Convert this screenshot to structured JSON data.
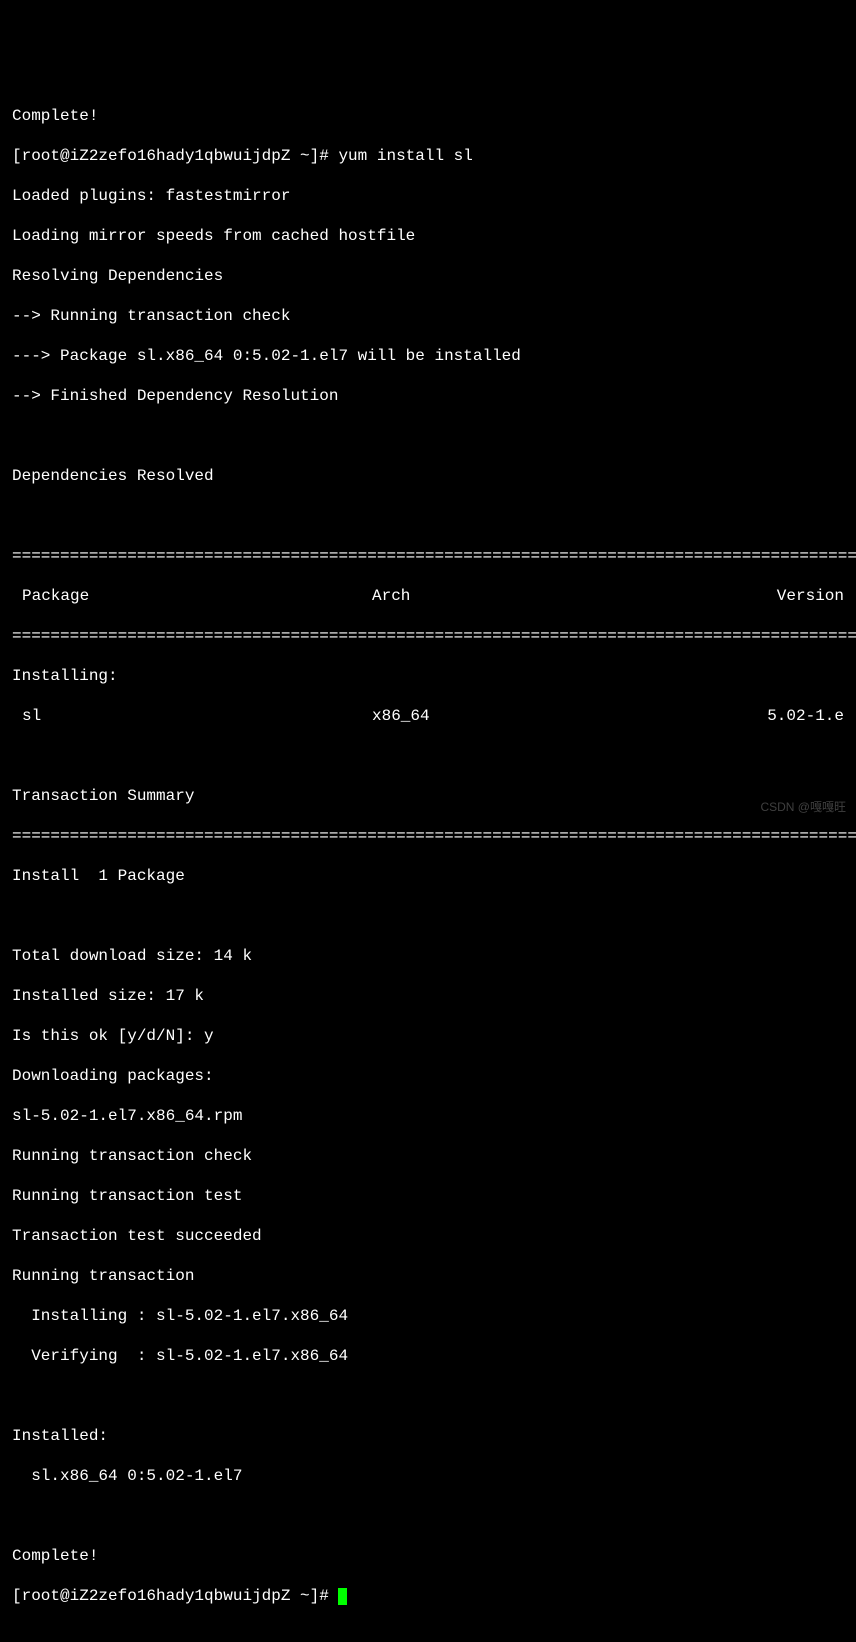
{
  "lines": {
    "complete1": "Complete!",
    "prompt1_user": "[root@iZ2zefo16hady1qbwuijdpZ ~]# ",
    "prompt1_cmd": "yum install sl",
    "loaded_plugins": "Loaded plugins: fastestmirror",
    "loading_mirror": "Loading mirror speeds from cached hostfile",
    "resolving": "Resolving Dependencies",
    "running_check": "--> Running transaction check",
    "package_install": "---> Package sl.x86_64 0:5.02-1.el7 will be installed",
    "finished_dep": "--> Finished Dependency Resolution",
    "deps_resolved": "Dependencies Resolved",
    "divider": "========================================================================================================",
    "header": {
      "package": "Package",
      "arch": "Arch",
      "version": "Version"
    },
    "installing": "Installing:",
    "row": {
      "package": "sl",
      "arch": "x86_64",
      "version": "5.02-1.e"
    },
    "transaction_summary": "Transaction Summary",
    "install_count": "Install  1 Package",
    "download_size": "Total download size: 14 k",
    "installed_size": "Installed size: 17 k",
    "is_this_ok": "Is this ok [y/d/N]: y",
    "downloading": "Downloading packages:",
    "rpm_file": "sl-5.02-1.el7.x86_64.rpm",
    "running_trans_check": "Running transaction check",
    "running_trans_test": "Running transaction test",
    "trans_succeeded": "Transaction test succeeded",
    "running_trans": "Running transaction",
    "installing_pkg": "  Installing : sl-5.02-1.el7.x86_64",
    "verifying_pkg": "  Verifying  : sl-5.02-1.el7.x86_64",
    "installed_label": "Installed:",
    "installed_pkg": "  sl.x86_64 0:5.02-1.el7",
    "complete2": "Complete!",
    "prompt2_user": "[root@iZ2zefo16hady1qbwuijdpZ ~]# "
  },
  "watermark": "CSDN @嘎嘎旺"
}
